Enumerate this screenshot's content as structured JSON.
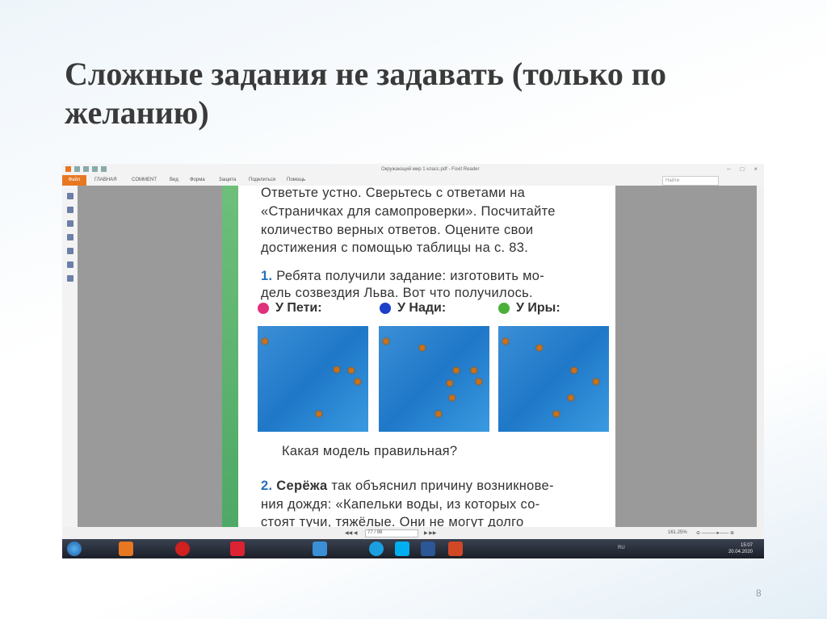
{
  "slide": {
    "title": "Сложные задания не задавать (только по желанию)",
    "number": "8"
  },
  "app": {
    "window_title": "Окружающий мир 1 класс.pdf - Foxit Reader",
    "tabs": [
      "Файл",
      "ГЛАВНАЯ",
      "COMMENT",
      "Вид",
      "Форма",
      "Защита",
      "Поделиться",
      "Помощь"
    ],
    "search_placeholder": "Найти"
  },
  "page": {
    "lines": [
      "Ответьте устно. Сверьтесь с ответами на",
      "«Страничках для самопроверки». Посчитайте",
      "количество верных ответов. Оцените свои",
      "достижения с помощью таблицы на с. 83."
    ],
    "task1_num": "1.",
    "task1_lines": [
      "Ребята получили задание: изготовить мо-",
      "дель созвездия Льва. Вот что получилось."
    ],
    "models": [
      {
        "label": "У Пети:",
        "color": "#e0307a"
      },
      {
        "label": "У Нади:",
        "color": "#1a3fc8"
      },
      {
        "label": "У Иры:",
        "color": "#4caf3a"
      }
    ],
    "question": "Какая модель правильная?",
    "task2_num": "2.",
    "task2_name": "Серёжа",
    "task2_lines": [
      "так объяснил причину возникнове-",
      "ния дождя: «Капельки воды, из которых со-",
      "стоят тучи, тяжёлые. Они не могут долго"
    ]
  },
  "status": {
    "page": "77 / 98",
    "zoom": "161.25%"
  },
  "taskbar": {
    "lang": "RU",
    "time": "15:07",
    "date": "20.04.2020"
  }
}
